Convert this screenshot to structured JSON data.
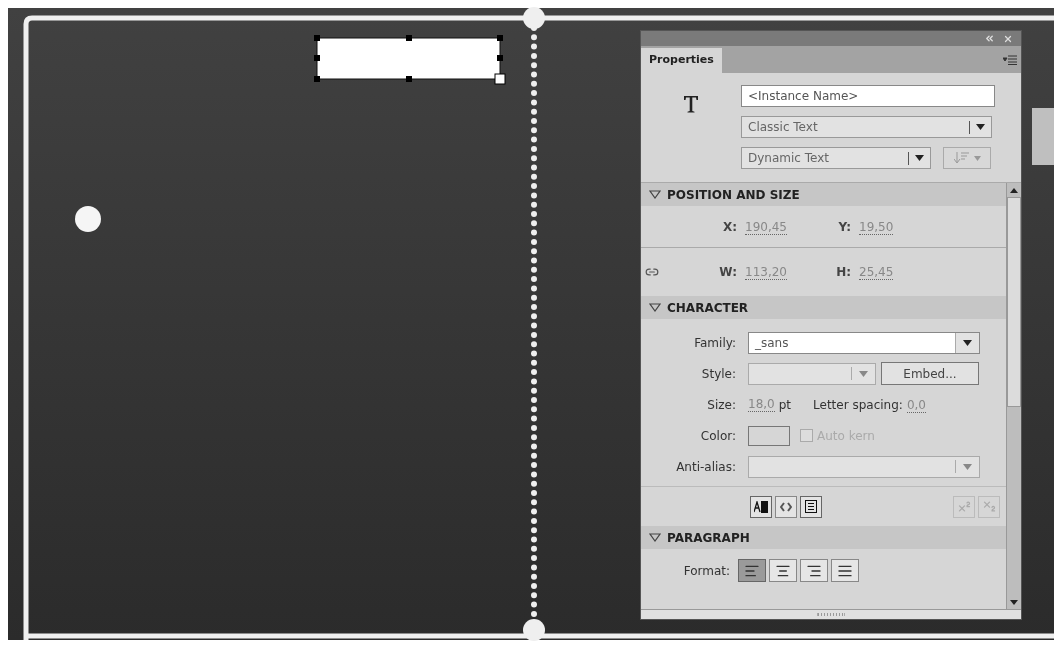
{
  "panel": {
    "tab": {
      "label": "Properties",
      "selected": true
    },
    "instance": {
      "placeholder": "<Instance Name>",
      "engine": "Classic Text",
      "text_type": "Dynamic Text"
    },
    "position_and_size": {
      "title": "POSITION AND SIZE",
      "expanded": true,
      "x_label": "X:",
      "x_value": "190,45",
      "y_label": "Y:",
      "y_value": "19,50",
      "w_label": "W:",
      "w_value": "113,20",
      "h_label": "H:",
      "h_value": "25,45"
    },
    "character": {
      "title": "CHARACTER",
      "expanded": true,
      "family_label": "Family:",
      "family_value": "_sans",
      "style_label": "Style:",
      "embed_button": "Embed...",
      "size_label": "Size:",
      "size_value": "18,0",
      "size_unit": "pt",
      "letter_spacing_label": "Letter spacing:",
      "letter_spacing_value": "0,0",
      "color_label": "Color:",
      "auto_kern": {
        "label": "Auto kern",
        "checked": false,
        "disabled": true
      },
      "anti_alias_label": "Anti-alias:"
    },
    "paragraph": {
      "title": "PARAGRAPH",
      "expanded": true,
      "format_label": "Format:",
      "align_buttons": [
        {
          "kind": "left",
          "selected": true
        },
        {
          "kind": "center",
          "selected": false
        },
        {
          "kind": "right",
          "selected": false
        },
        {
          "kind": "justify",
          "selected": false
        }
      ]
    }
  }
}
